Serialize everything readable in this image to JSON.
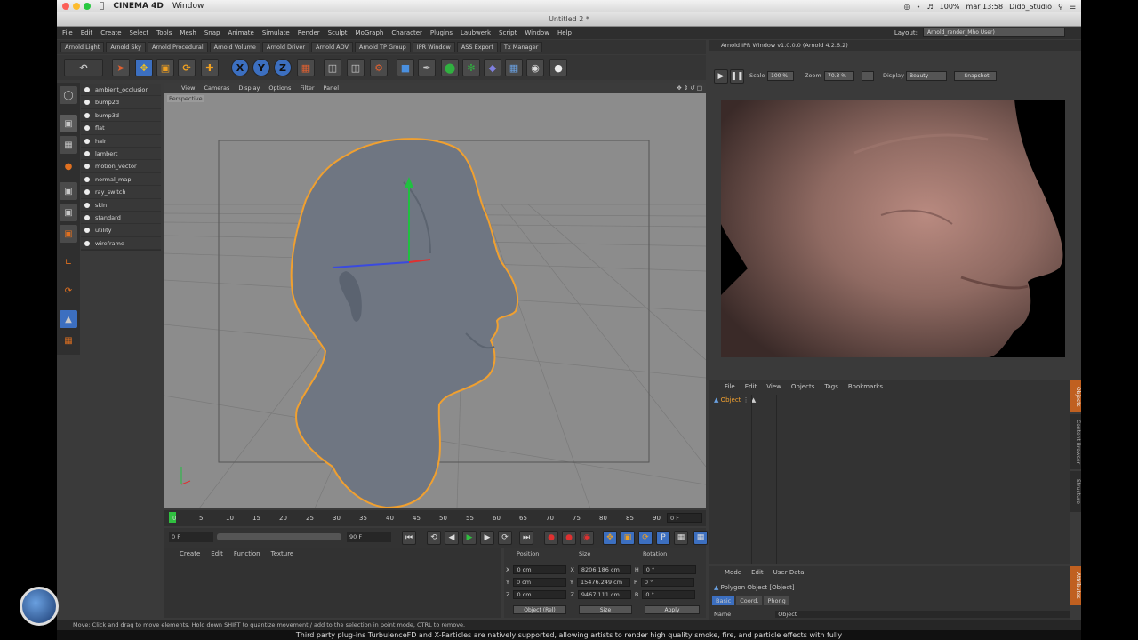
{
  "mac_menubar": {
    "app_name": "CINEMA 4D",
    "menu": "Window",
    "battery": "100%",
    "clock": "mar 13:58",
    "user": "Dido_Studio"
  },
  "window_title": "Untitled 2 *",
  "c4d_menu": [
    "File",
    "Edit",
    "Create",
    "Select",
    "Tools",
    "Mesh",
    "Snap",
    "Animate",
    "Simulate",
    "Render",
    "Sculpt",
    "MoGraph",
    "Character",
    "Plugins",
    "Laubwerk",
    "Script",
    "Window",
    "Help"
  ],
  "layout": {
    "label": "Layout:",
    "value": "Arnold_render_Mho User)"
  },
  "arnold_bar": [
    "Arnold Light",
    "Arnold Sky",
    "Arnold Procedural",
    "Arnold Volume",
    "Arnold Driver",
    "Arnold AOV",
    "Arnold TP Group",
    "IPR Window",
    "ASS Export",
    "Tx Manager"
  ],
  "toolbar": {
    "axis_x": "X",
    "axis_y": "Y",
    "axis_z": "Z"
  },
  "shader_list": [
    "ambient_occlusion",
    "bump2d",
    "bump3d",
    "flat",
    "hair",
    "lambert",
    "motion_vector",
    "normal_map",
    "ray_switch",
    "skin",
    "standard",
    "utility",
    "wireframe"
  ],
  "viewport": {
    "menu": [
      "View",
      "Cameras",
      "Display",
      "Options",
      "Filter",
      "Panel"
    ],
    "label": "Perspective"
  },
  "timeline": {
    "ticks": [
      "0",
      "5",
      "10",
      "15",
      "20",
      "25",
      "30",
      "35",
      "40",
      "45",
      "50",
      "55",
      "60",
      "65",
      "70",
      "75",
      "80",
      "85",
      "90"
    ],
    "current_frame": "0 F"
  },
  "transport": {
    "start": "0 F",
    "end": "90 F"
  },
  "material_manager": {
    "menu": [
      "Create",
      "Edit",
      "Function",
      "Texture"
    ]
  },
  "coordinates": {
    "headers": [
      "Position",
      "Size",
      "Rotation"
    ],
    "rows": [
      {
        "axis": "X",
        "pos": "0 cm",
        "size_axis": "X",
        "size": "8206.186 cm",
        "rot_axis": "H",
        "rot": "0 °"
      },
      {
        "axis": "Y",
        "pos": "0 cm",
        "size_axis": "Y",
        "size": "15476.249 cm",
        "rot_axis": "P",
        "rot": "0 °"
      },
      {
        "axis": "Z",
        "pos": "0 cm",
        "size_axis": "Z",
        "size": "9467.111 cm",
        "rot_axis": "B",
        "rot": "0 °"
      }
    ],
    "mode": "Object (Rel)",
    "size_mode": "Size",
    "apply": "Apply"
  },
  "ipr": {
    "title": "Arnold IPR Window v1.0.0.0 (Arnold 4.2.6.2)",
    "scale_label": "Scale",
    "scale": "100 %",
    "zoom_label": "Zoom",
    "zoom": "70.3 %",
    "display_label": "Display",
    "display": "Beauty",
    "snapshot": "Snapshot"
  },
  "object_manager": {
    "menu": [
      "File",
      "Edit",
      "View",
      "Objects",
      "Tags",
      "Bookmarks"
    ],
    "object_name": "Object"
  },
  "attribute_manager": {
    "menu": [
      "Mode",
      "Edit",
      "User Data"
    ],
    "title": "Polygon Object [Object]",
    "tabs": [
      "Basic",
      "Coord.",
      "Phong"
    ],
    "field_label": "Name",
    "field_value": "Object"
  },
  "side_tabs": [
    "Objects",
    "Content Browser",
    "Structure",
    "Attributes"
  ],
  "status_text": "Move: Click and drag to move elements. Hold down SHIFT to quantize movement / add to the selection in point mode, CTRL to remove.",
  "caption": "Third party plug-ins TurbulenceFD and X-Particles are natively supported, allowing artists to render high quality smoke, fire, and particle effects with fully",
  "colors": {
    "selection_orange": "#f0a030",
    "ui_dark": "#333333",
    "accent_blue": "#3c6fc0"
  }
}
